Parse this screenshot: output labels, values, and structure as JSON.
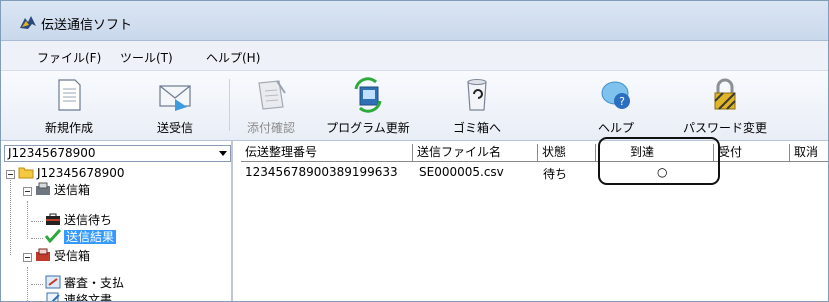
{
  "window": {
    "title": "伝送通信ソフト"
  },
  "menu": [
    "ファイル(F)",
    "ツール(T)",
    "ヘルプ(H)"
  ],
  "toolbar": [
    {
      "label": "新規作成",
      "icon": "document-icon",
      "enabled": true
    },
    {
      "label": "送受信",
      "icon": "envelope-icon",
      "enabled": true
    },
    {
      "label": "添付確認",
      "icon": "attachment-check-icon",
      "enabled": false
    },
    {
      "label": "プログラム更新",
      "icon": "program-update-icon",
      "enabled": true
    },
    {
      "label": "ゴミ箱へ",
      "icon": "trash-icon",
      "enabled": true
    },
    {
      "label": "ヘルプ",
      "icon": "help-icon",
      "enabled": true
    },
    {
      "label": "パスワード変更",
      "icon": "lock-icon",
      "enabled": true
    }
  ],
  "account_select": {
    "value": "J12345678900"
  },
  "tree": {
    "root": "J12345678900",
    "outbox": {
      "label": "送信箱",
      "children": [
        "送信待ち",
        "送信結果"
      ],
      "selected": "送信結果"
    },
    "inbox": {
      "label": "受信箱",
      "children": [
        "審査・支払",
        "連絡文書"
      ]
    }
  },
  "table": {
    "columns": [
      "伝送整理番号",
      "送信ファイル名",
      "状態",
      "到達",
      "受付",
      "取消"
    ],
    "rows": [
      {
        "number": "12345678900389199633",
        "file": "SE000005.csv",
        "status": "待ち",
        "arrival": "○",
        "accepted": "",
        "cancel": ""
      }
    ]
  },
  "colors": {
    "selection": "#3399ff",
    "titlebar": "#c9d8ec",
    "toolbar": "#e9eef6"
  }
}
